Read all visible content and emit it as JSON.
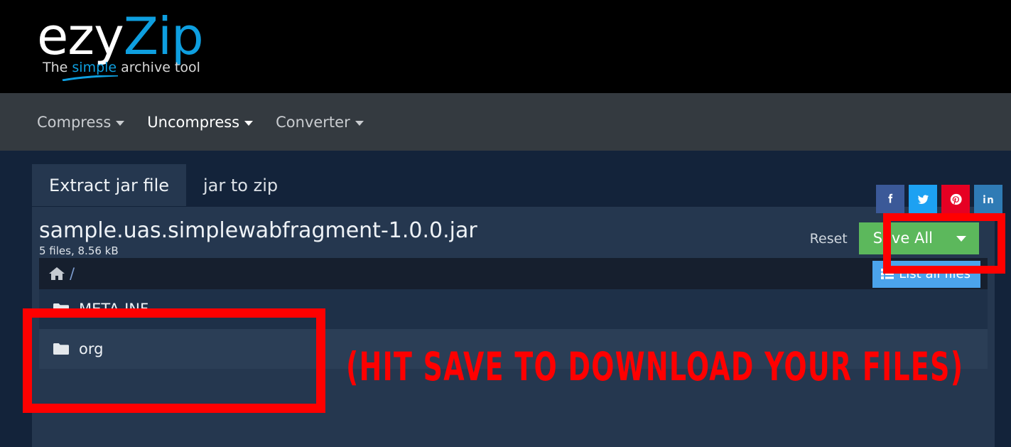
{
  "header": {
    "logo_primary": "ezy",
    "logo_secondary": "Zip",
    "tagline_prefix": "The ",
    "tagline_highlight": "simple",
    "tagline_suffix": " archive tool",
    "brand_blue": "#0e9fe0"
  },
  "navbar": {
    "items": [
      {
        "label": "Compress",
        "active": false
      },
      {
        "label": "Uncompress",
        "active": true
      },
      {
        "label": "Converter",
        "active": false
      }
    ]
  },
  "social": [
    {
      "name": "facebook",
      "color": "#3b5998"
    },
    {
      "name": "twitter",
      "color": "#1da1f2"
    },
    {
      "name": "pinterest",
      "color": "#e60023"
    },
    {
      "name": "linkedin",
      "color": "#2f7bb5"
    }
  ],
  "tabs": [
    {
      "label": "Extract jar file",
      "active": true
    },
    {
      "label": "jar to zip",
      "active": false
    }
  ],
  "file_info": {
    "name": "sample.uas.simplewabfragment-1.0.0.jar",
    "summary": "5 files, 8.56 kB"
  },
  "actions": {
    "reset_label": "Reset",
    "save_all_label": "Save All",
    "save_all_color": "#5cb85c",
    "list_all_files_label": "List all files",
    "list_all_files_color": "#4ba3eb"
  },
  "breadcrumb": {
    "home_icon": "home-icon",
    "separator": "/"
  },
  "file_list": {
    "items": [
      {
        "name": "META-INF",
        "type": "folder"
      },
      {
        "name": "org",
        "type": "folder"
      }
    ]
  },
  "annotations": {
    "color": "#ff0000",
    "callout_text": "(HIT SAVE TO DOWNLOAD YOUR FILES)",
    "boxes": [
      "save-all-button",
      "folder-list"
    ]
  }
}
